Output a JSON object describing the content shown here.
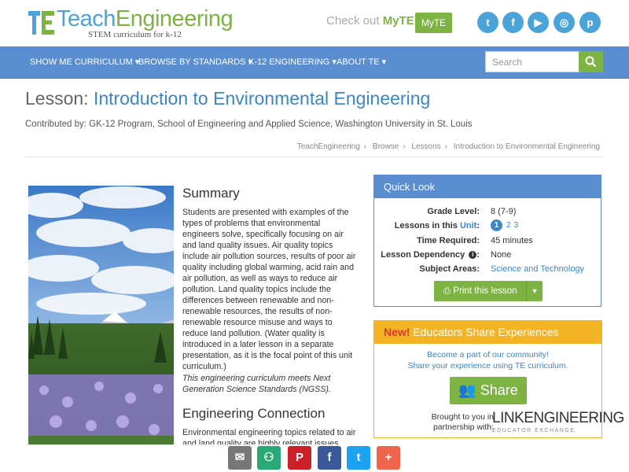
{
  "brand": {
    "teach": "Teach",
    "engineering": "Engineering",
    "tagline": "STEM curriculum for k-12"
  },
  "header": {
    "checkout_text": "Check out",
    "myte_word": "MyTE",
    "myte_button": "MyTE",
    "social": [
      {
        "icon": "twitter-icon",
        "glyph": "t"
      },
      {
        "icon": "facebook-icon",
        "glyph": "f"
      },
      {
        "icon": "youtube-icon",
        "glyph": "▶"
      },
      {
        "icon": "instagram-icon",
        "glyph": "◎"
      },
      {
        "icon": "pinterest-icon",
        "glyph": "p"
      }
    ]
  },
  "nav": {
    "items": [
      {
        "label": "SHOW ME CURRICULUM"
      },
      {
        "label": "BROWSE BY STANDARDS"
      },
      {
        "label": "K-12 ENGINEERING"
      },
      {
        "label": "ABOUT TE"
      }
    ],
    "search_placeholder": "Search"
  },
  "page": {
    "title_prefix": "Lesson:",
    "title": "Introduction to Environmental Engineering",
    "contributed": "Contributed by: GK-12 Program, School of Engineering and Applied Science, Washington University in St. Louis",
    "breadcrumb": [
      "TeachEngineering",
      "Browse",
      "Lessons",
      "Introduction to Environmental Engineering"
    ]
  },
  "content": {
    "summary_heading": "Summary",
    "summary_text": "Students are presented with examples of the types of problems that environmental engineers solve, specifically focusing on air and land quality issues. Air quality topics include air pollution sources, results of poor air quality including global warming, acid rain and air pollution, as well as ways to reduce air pollution. Land quality topics include the differences between renewable and non-renewable resources, the results of non-renewable resource misuse and ways to reduce land pollution. (Water quality is introduced in a later lesson in a separate presentation, as it is the focal point of this unit curriculum.)",
    "ngss_note": "This engineering curriculum meets Next Generation Science Standards (NGSS).",
    "engineering_heading": "Engineering Connection",
    "engineering_text": "Environmental engineering topics related to air and land quality are highly relevant issues"
  },
  "quick_look": {
    "heading": "Quick Look",
    "grade_label": "Grade Level:",
    "grade_value": "8 (7-9)",
    "lessons_label_prefix": "Lessons in this",
    "lessons_label_link": "Unit",
    "lessons_label_suffix": ":",
    "lesson_current": "1",
    "lesson_2": "2",
    "lesson_3": "3",
    "time_label": "Time Required:",
    "time_value": "45 minutes",
    "dependency_label": "Lesson Dependency",
    "dependency_value": "None",
    "subject_label": "Subject Areas:",
    "subject_value": "Science and Technology",
    "print_button": "Print this lesson"
  },
  "educators": {
    "new_label": "New!",
    "heading": "Educators Share Experiences",
    "line1": "Become a part of our community!",
    "line2": "Share your experience using TE curriculum.",
    "share_button": "Share",
    "brought_by": "Brought to you in partnership with:",
    "partner_word": "LINKENGINEERING",
    "partner_sub": "EDUCATOR EXCHANGE"
  },
  "share_bar": [
    {
      "icon": "email-icon",
      "glyph": "✉",
      "color": "#777777"
    },
    {
      "icon": "share-group-icon",
      "glyph": "⚇",
      "color": "#2aa876"
    },
    {
      "icon": "pinterest-icon",
      "glyph": "P",
      "color": "#cb2027"
    },
    {
      "icon": "facebook-icon",
      "glyph": "f",
      "color": "#3b5998"
    },
    {
      "icon": "twitter-icon",
      "glyph": "t",
      "color": "#1da1f2"
    },
    {
      "icon": "more-icon",
      "glyph": "+",
      "color": "#f0654b"
    }
  ],
  "colors": {
    "brand_blue": "#4aa3d9",
    "brand_green": "#7cb342",
    "nav_blue": "#5a8ed0",
    "link_blue": "#3a87c8",
    "edu_orange": "#f4b324"
  }
}
